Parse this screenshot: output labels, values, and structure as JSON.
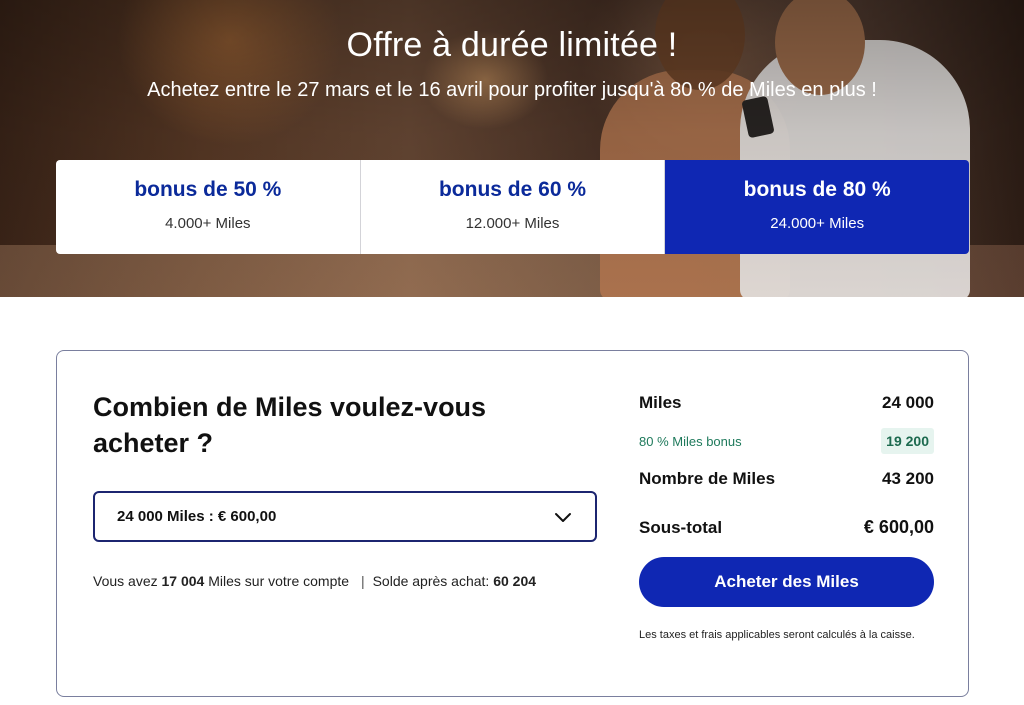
{
  "hero": {
    "title": "Offre à durée limitée !",
    "subtitle": "Achetez entre le 27 mars et le 16 avril pour profiter jusqu'à 80 % de Miles en plus !"
  },
  "bonus_options": [
    {
      "title": "bonus de 50 %",
      "miles": "4.000+ Miles",
      "selected": false
    },
    {
      "title": "bonus de 60 %",
      "miles": "12.000+ Miles",
      "selected": false
    },
    {
      "title": "bonus de 80 %",
      "miles": "24.000+ Miles",
      "selected": true
    }
  ],
  "purchase": {
    "heading": "Combien de Miles voulez-vous acheter ?",
    "select_value": "24 000 Miles : € 600,00",
    "balance": {
      "prefix": "Vous avez",
      "current_miles": "17 004",
      "suffix": "Miles sur votre compte",
      "separator": "|",
      "after_label": "Solde après achat:",
      "after_value": "60 204"
    }
  },
  "summary": {
    "miles_label": "Miles",
    "miles_value": "24 000",
    "bonus_label": "80 % Miles bonus",
    "bonus_value": "19 200",
    "total_label": "Nombre de Miles",
    "total_value": "43 200",
    "subtotal_label": "Sous-total",
    "subtotal_value": "€ 600,00",
    "buy_button": "Acheter des Miles",
    "tax_note": "Les taxes et frais applicables seront calculés à la caisse."
  },
  "colors": {
    "brand_blue": "#0f27b3",
    "heading_blue": "#0b2a9a",
    "bonus_green": "#1f7a5c"
  }
}
